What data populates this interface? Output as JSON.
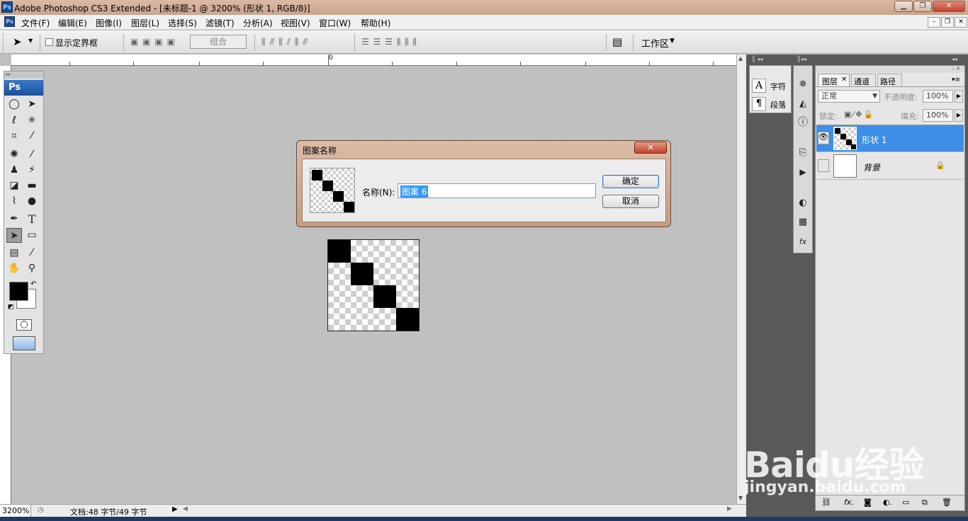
{
  "window": {
    "title": "Adobe Photoshop CS3 Extended - [未标题-1 @ 3200% (形状 1, RGB/8)]",
    "app_icon": "Ps"
  },
  "menu": [
    "文件(F)",
    "编辑(E)",
    "图像(I)",
    "图层(L)",
    "选择(S)",
    "滤镜(T)",
    "分析(A)",
    "视图(V)",
    "窗口(W)",
    "帮助(H)"
  ],
  "options": {
    "show_bounds": "显示定界框",
    "combine": "组合",
    "workspace": "工作区"
  },
  "ruler": {
    "zero": "0"
  },
  "status": {
    "zoom": "3200%",
    "doc": "文档:48 字节/49 字节"
  },
  "toolbox": {
    "logo": "Ps"
  },
  "dialog": {
    "title": "图案名称",
    "name_label": "名称(N):",
    "name_value": "图案 6",
    "ok": "确定",
    "cancel": "取消"
  },
  "char_panel": {
    "char_tab": "字符",
    "para_tab": "段落"
  },
  "layers_panel": {
    "tabs": [
      "图层",
      "通道",
      "路径"
    ],
    "blend_mode": "正常",
    "opacity_label": "不透明度:",
    "opacity": "100%",
    "lock_label": "锁定:",
    "fill_label": "填充:",
    "fill": "100%",
    "layers": [
      {
        "name": "形状 1",
        "selected": true,
        "visible": true
      },
      {
        "name": "背景",
        "selected": false,
        "visible": false,
        "locked": true
      }
    ]
  },
  "watermark": {
    "brand": "Baidu经验",
    "url": "jingyan.baidu.com"
  },
  "colors": {
    "selection": "#3d8ee6",
    "title_bar": "#d4b09a"
  }
}
